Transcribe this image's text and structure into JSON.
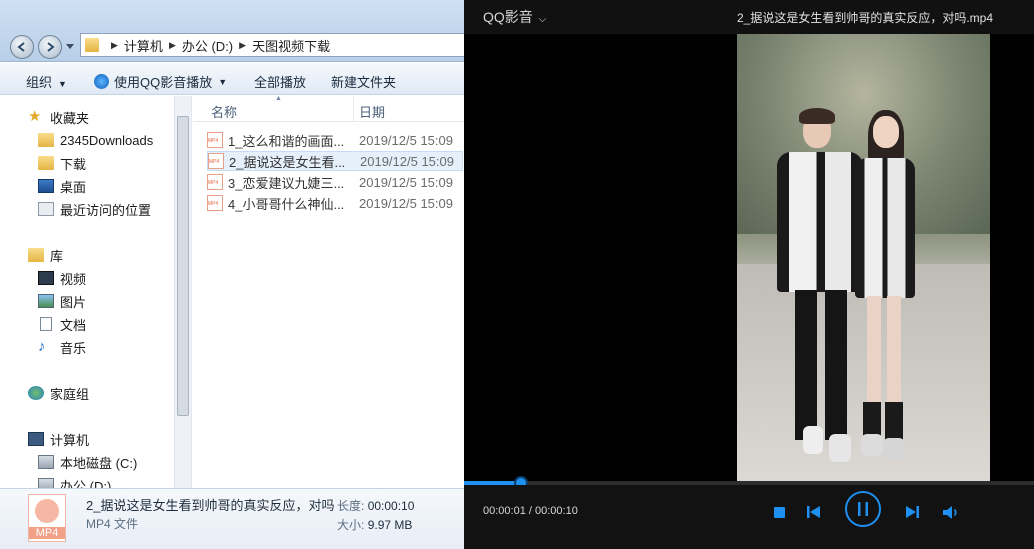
{
  "explorer": {
    "breadcrumbs": [
      "计算机",
      "办公 (D:)",
      "天图视频下载"
    ],
    "toolbar": {
      "organize": "组织",
      "play_with": "使用QQ影音播放",
      "play_all": "全部播放",
      "new_folder": "新建文件夹"
    },
    "nav": {
      "favorites": "收藏夹",
      "fav_items": [
        "2345Downloads",
        "下载",
        "桌面",
        "最近访问的位置"
      ],
      "libraries": "库",
      "lib_items": [
        "视频",
        "图片",
        "文档",
        "音乐"
      ],
      "homegroup": "家庭组",
      "computer": "计算机",
      "comp_items": [
        "本地磁盘 (C:)",
        "办公 (D:)"
      ]
    },
    "columns": {
      "name": "名称",
      "date": "日期"
    },
    "files": [
      {
        "name": "1_这么和谐的画面...",
        "date": "2019/12/5 15:09"
      },
      {
        "name": "2_据说这是女生看...",
        "date": "2019/12/5 15:09"
      },
      {
        "name": "3_恋爱建议九婕三...",
        "date": "2019/12/5 15:09"
      },
      {
        "name": "4_小哥哥什么神仙...",
        "date": "2019/12/5 15:09"
      }
    ],
    "details": {
      "filename": "2_据说这是女生看到帅哥的真实反应，对吗",
      "type": "MP4 文件",
      "icon_label": "MP4",
      "length_label": "长度:",
      "length_value": "00:00:10",
      "size_label": "大小:",
      "size_value": "9.97 MB"
    }
  },
  "player": {
    "app_name": "QQ影音",
    "title": "2_据说这是女生看到帅哥的真实反应，对吗.mp4",
    "time_display": "00:00:01 / 00:00:10",
    "progress": 0.1,
    "accent": "#1f8ff0"
  }
}
